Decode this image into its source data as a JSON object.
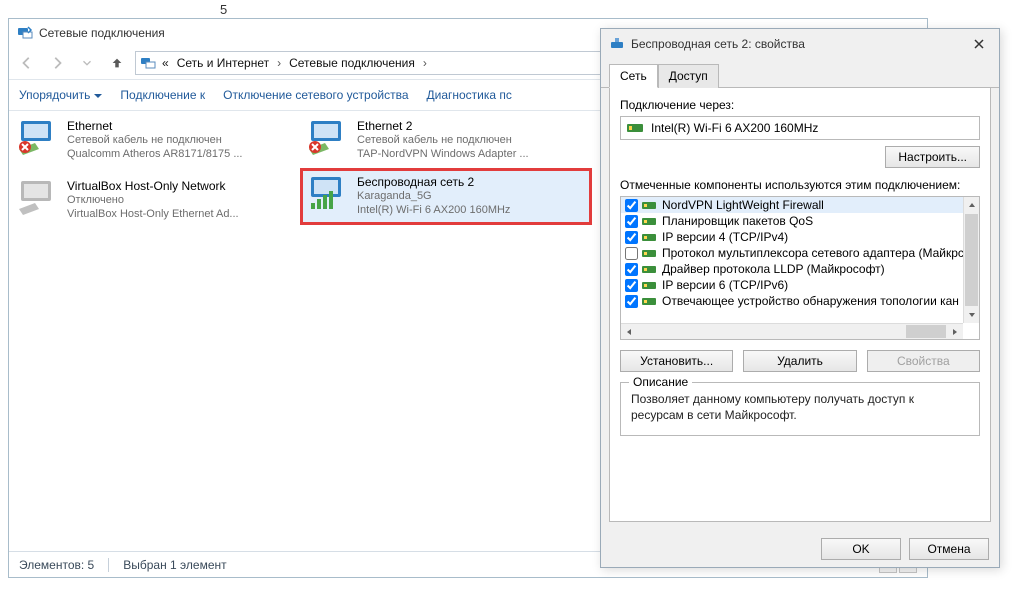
{
  "page_number": "5",
  "explorer": {
    "title": "Сетевые подключения",
    "breadcrumbs": {
      "sep": "«",
      "item1": "Сеть и Интернет",
      "item2": "Сетевые подключения",
      "arrow": "›"
    },
    "toolbar": {
      "organize": "Упорядочить",
      "connect_to": "Подключение к",
      "disable": "Отключение сетевого устройства",
      "diagnose": "Диагностика пс"
    },
    "connections": [
      {
        "name": "Ethernet",
        "status": "Сетевой кабель не подключен",
        "device": "Qualcomm Atheros AR8171/8175 ..."
      },
      {
        "name": "Ethernet 2",
        "status": "Сетевой кабель не подключен",
        "device": "TAP-NordVPN Windows Adapter ..."
      },
      {
        "name": "VirtualBox Host-Only Network",
        "status": "Отключено",
        "device": "VirtualBox Host-Only Ethernet Ad..."
      },
      {
        "name": "Беспроводная сеть 2",
        "status": "Karaganda_5G",
        "device": "Intel(R) Wi-Fi 6 AX200 160MHz"
      }
    ],
    "status_bar": {
      "elements": "Элементов: 5",
      "selected": "Выбран 1 элемент"
    }
  },
  "properties": {
    "title": "Беспроводная сеть 2: свойства",
    "tabs": {
      "network": "Сеть",
      "access": "Доступ"
    },
    "connect_via_label": "Подключение через:",
    "adapter": "Intel(R) Wi-Fi 6 AX200 160MHz",
    "configure_btn": "Настроить...",
    "components_label": "Отмеченные компоненты используются этим подключением:",
    "components": [
      {
        "checked": true,
        "label": "NordVPN LightWeight Firewall"
      },
      {
        "checked": true,
        "label": "Планировщик пакетов QoS"
      },
      {
        "checked": true,
        "label": "IP версии 4 (TCP/IPv4)"
      },
      {
        "checked": false,
        "label": "Протокол мультиплексора сетевого адаптера (Майкрс"
      },
      {
        "checked": true,
        "label": "Драйвер протокола LLDP (Майкрософт)"
      },
      {
        "checked": true,
        "label": "IP версии 6 (TCP/IPv6)"
      },
      {
        "checked": true,
        "label": "Отвечающее устройство обнаружения топологии кан"
      }
    ],
    "install_btn": "Установить...",
    "remove_btn": "Удалить",
    "props_btn": "Свойства",
    "desc_title": "Описание",
    "desc_text": "Позволяет данному компьютеру получать доступ к ресурсам в сети Майкрософт.",
    "ok_btn": "OK",
    "cancel_btn": "Отмена"
  }
}
